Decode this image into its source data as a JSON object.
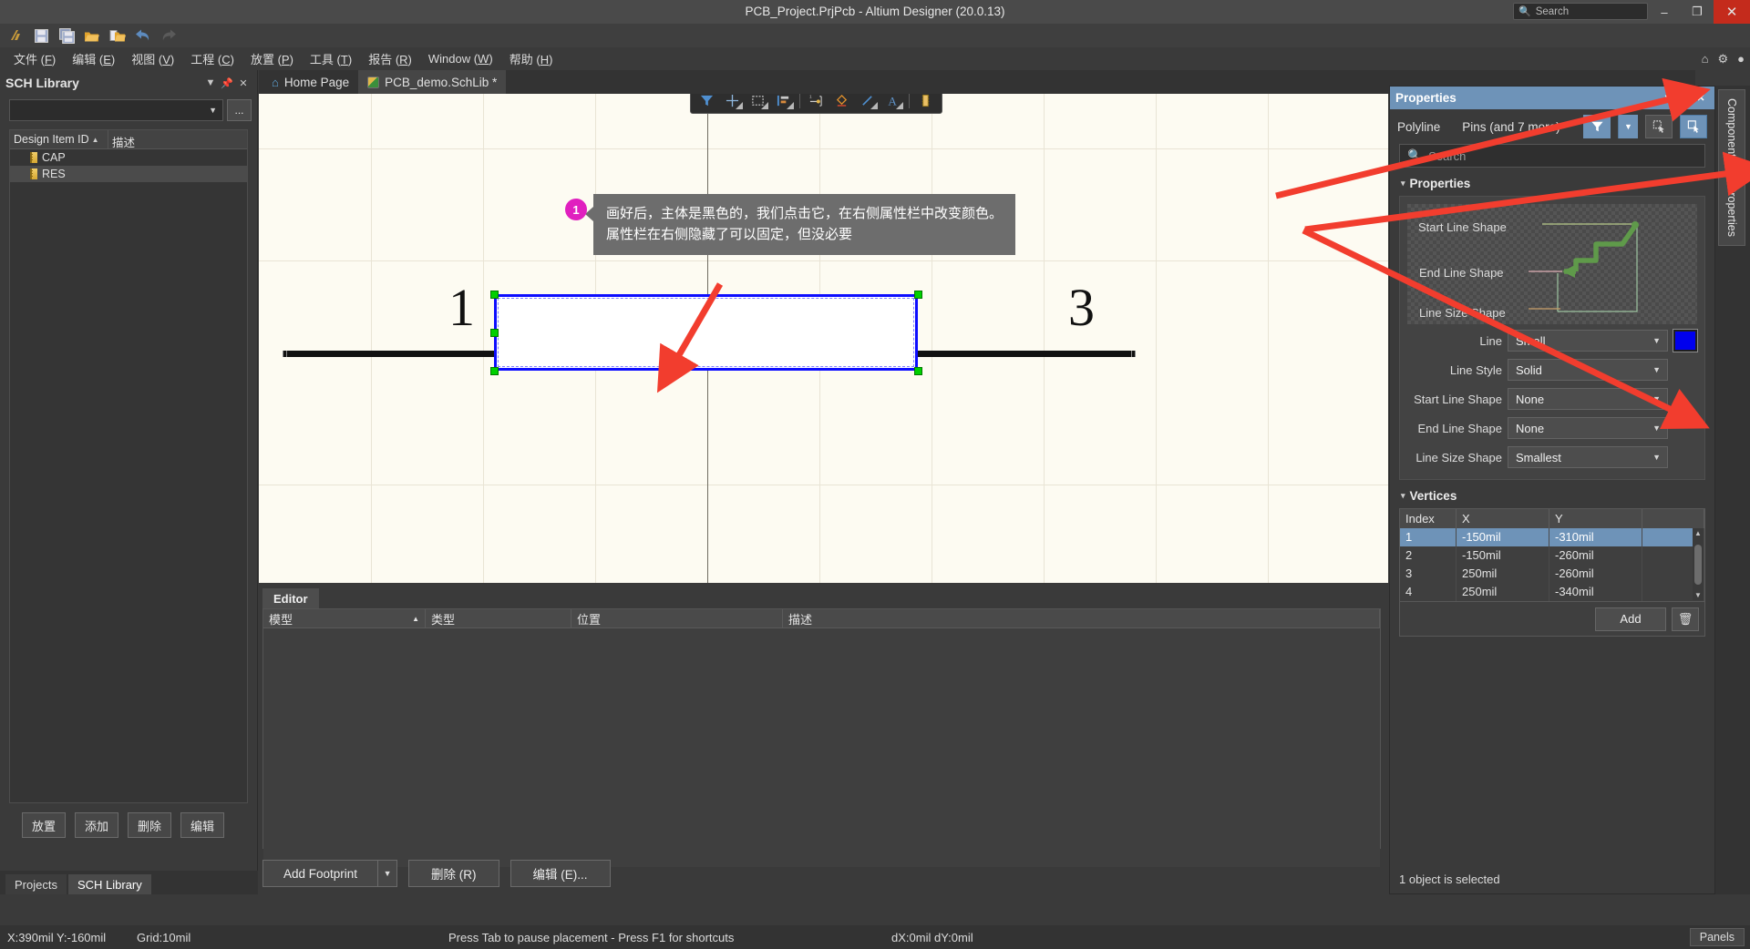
{
  "window": {
    "title": "PCB_Project.PrjPcb - Altium Designer (20.0.13)",
    "search_placeholder": "Search",
    "minimize": "–",
    "maximize": "❐",
    "close": "✕"
  },
  "quick_access": [
    {
      "name": "altium-logo-icon",
      "label": "A"
    },
    {
      "name": "save-icon",
      "label": "Save"
    },
    {
      "name": "save-all-icon",
      "label": "Save All"
    },
    {
      "name": "open-icon",
      "label": "Open"
    },
    {
      "name": "open-project-icon",
      "label": "Open Project"
    },
    {
      "name": "undo-icon",
      "label": "Undo"
    },
    {
      "name": "redo-icon",
      "label": "Redo"
    }
  ],
  "menu": {
    "items": [
      {
        "label": "文件",
        "accel": "F"
      },
      {
        "label": "编辑",
        "accel": "E"
      },
      {
        "label": "视图",
        "accel": "V"
      },
      {
        "label": "工程",
        "accel": "C"
      },
      {
        "label": "放置",
        "accel": "P"
      },
      {
        "label": "工具",
        "accel": "T"
      },
      {
        "label": "报告",
        "accel": "R"
      },
      {
        "label": "Window",
        "accel": "W"
      },
      {
        "label": "帮助",
        "accel": "H"
      }
    ],
    "right_icons": [
      "home-icon",
      "gear-icon",
      "user-icon"
    ]
  },
  "sidebar": {
    "title": "SCH Library",
    "header_icons": [
      "chevron-down-icon",
      "pin-icon",
      "close-icon"
    ],
    "combo_value": "",
    "ellipsis_label": "...",
    "table": {
      "columns": [
        "Design Item ID",
        "描述"
      ],
      "sort_indicator": "▲",
      "rows": [
        {
          "id": "CAP",
          "desc": ""
        },
        {
          "id": "RES",
          "desc": ""
        }
      ],
      "selected_index": 1
    },
    "buttons": [
      {
        "name": "place-button",
        "label": "放置"
      },
      {
        "name": "add-button",
        "label": "添加"
      },
      {
        "name": "delete-button",
        "label": "删除"
      },
      {
        "name": "edit-button",
        "label": "编辑"
      }
    ],
    "bottom_tabs": [
      {
        "label": "Projects",
        "active": false
      },
      {
        "label": "SCH Library",
        "active": true
      }
    ]
  },
  "doc_tabs": [
    {
      "label": "Home Page",
      "icon": "home-icon",
      "active": false
    },
    {
      "label": "PCB_demo.SchLib *",
      "icon": "schlib-icon",
      "active": true
    }
  ],
  "canvas_toolbar": [
    {
      "name": "filter-icon",
      "menu": false
    },
    {
      "name": "crosshair-place-icon",
      "menu": true
    },
    {
      "name": "rectangle-select-icon",
      "menu": true
    },
    {
      "name": "align-icon",
      "menu": true
    },
    {
      "name": "place-pin-icon",
      "menu": false
    },
    {
      "name": "place-polygon-icon",
      "menu": false
    },
    {
      "name": "place-line-icon",
      "menu": true
    },
    {
      "name": "place-text-icon",
      "menu": true
    },
    {
      "name": "place-component-icon",
      "menu": false
    }
  ],
  "callout": {
    "badge": "1",
    "text": "画好后，主体是黑色的，我们点击它，在右侧属性栏中改变颜色。\n属性栏在右侧隐藏了可以固定，但没必要"
  },
  "symbol": {
    "pin_left_number": "1",
    "pin_right_number": "3",
    "body_color": "#0000ee"
  },
  "editor": {
    "tab": "Editor",
    "columns": [
      "模型",
      "类型",
      "位置",
      "描述"
    ],
    "sort_indicator": "▲",
    "rows": [],
    "buttons": {
      "add_footprint": "Add Footprint",
      "delete": "删除 (R)",
      "edit": "编辑 (E)..."
    }
  },
  "properties": {
    "title": "Properties",
    "header_icons": [
      "chevron-down-icon",
      "pin-icon",
      "close-icon"
    ],
    "object_type": "Polyline",
    "selection_scope": "Pins (and 7 more)",
    "search_placeholder": "Search",
    "section_properties": "Properties",
    "illustration": {
      "labels": [
        "Start Line Shape",
        "End Line Shape",
        "Line Size Shape"
      ]
    },
    "fields": [
      {
        "label": "Line",
        "value": "Small",
        "has_color": true,
        "color": "#0000ee"
      },
      {
        "label": "Line Style",
        "value": "Solid",
        "has_color": false
      },
      {
        "label": "Start Line Shape",
        "value": "None",
        "has_color": false
      },
      {
        "label": "End Line Shape",
        "value": "None",
        "has_color": false
      },
      {
        "label": "Line Size Shape",
        "value": "Smallest",
        "has_color": false
      }
    ],
    "section_vertices": "Vertices",
    "vertices": {
      "columns": [
        "Index",
        "X",
        "Y"
      ],
      "rows": [
        {
          "index": "1",
          "x": "-150mil",
          "y": "-310mil",
          "selected": true
        },
        {
          "index": "2",
          "x": "-150mil",
          "y": "-260mil",
          "selected": false
        },
        {
          "index": "3",
          "x": "250mil",
          "y": "-260mil",
          "selected": false
        },
        {
          "index": "4",
          "x": "250mil",
          "y": "-340mil",
          "selected": false
        }
      ],
      "add_label": "Add",
      "delete_icon": "trash-icon"
    },
    "status": "1 object is selected"
  },
  "right_tabs": [
    {
      "label": "Components"
    },
    {
      "label": "Properties"
    }
  ],
  "statusbar": {
    "coords": "X:390mil Y:-160mil",
    "grid": "Grid:10mil",
    "hint": "Press Tab to pause placement - Press F1 for shortcuts",
    "delta": "dX:0mil dY:0mil",
    "panels": "Panels"
  }
}
